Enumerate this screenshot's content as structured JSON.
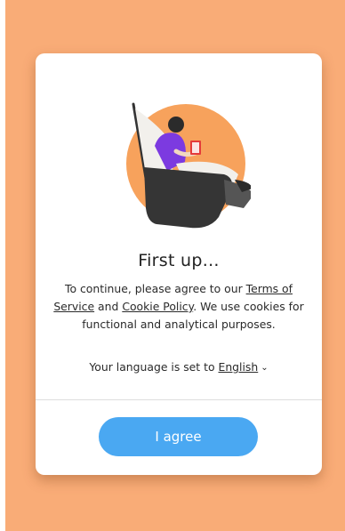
{
  "dialog": {
    "title": "First up...",
    "consent": {
      "prefix": "To continue, please agree to our ",
      "terms_link": "Terms of Service",
      "middle": " and ",
      "cookie_link": "Cookie Policy",
      "suffix": ". We use cookies for functional and analytical purposes."
    },
    "language": {
      "prefix": "Your language is set to ",
      "value": "English",
      "chevron_icon": "chevron-down-icon"
    },
    "agree_label": "I agree"
  },
  "illustration": {
    "icon": "reading-person-illustration",
    "colors": {
      "circle": "#f7a25c",
      "chair": "#333333",
      "shirt": "#7c3ae0",
      "book": "#e43a3a"
    }
  },
  "colors": {
    "backdrop": "#f9ac77",
    "button": "#4aa8f2",
    "card": "#ffffff"
  }
}
